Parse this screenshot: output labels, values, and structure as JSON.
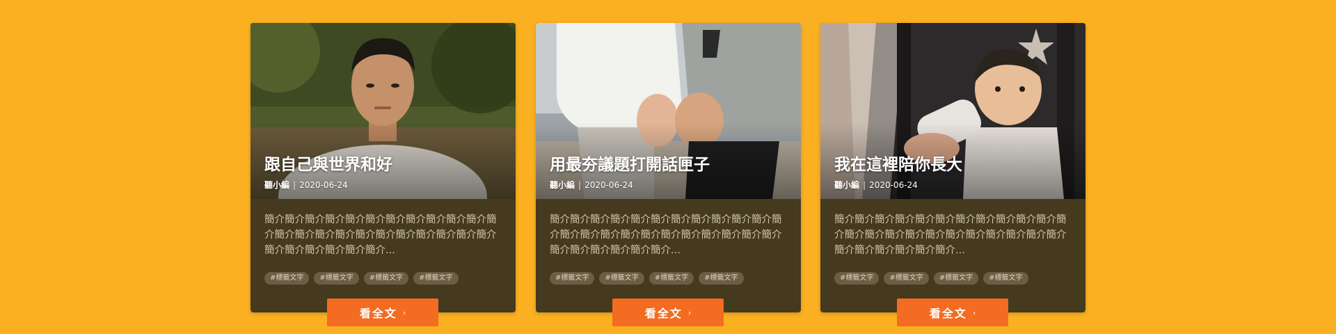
{
  "theme": {
    "background": "#FBB021",
    "card": "#45391E",
    "accent": "#F36C21",
    "tag": "#6B5E44"
  },
  "cards": [
    {
      "image": "portrait-young-man-photo",
      "title": "跟自己與世界和好",
      "author": "聽小編",
      "separator": "|",
      "date": "2020-06-24",
      "excerpt": "簡介簡介簡介簡介簡介簡介簡介簡介簡介簡介簡介簡介簡介簡介簡介簡介簡介簡介簡介簡介簡介簡介簡介簡介簡介簡介簡介簡介簡介...",
      "tags": [
        "#標籤文字",
        "#標籤文字",
        "#標籤文字",
        "#標籤文字"
      ],
      "cta": "看全文",
      "cta_icon": "›"
    },
    {
      "image": "pregnant-couple-beach-photo",
      "title": "用最夯議題打開話匣子",
      "author": "聽小編",
      "separator": "|",
      "date": "2020-06-24",
      "excerpt": "簡介簡介簡介簡介簡介簡介簡介簡介簡介簡介簡介簡介簡介簡介簡介簡介簡介簡介簡介簡介簡介簡介簡介簡介簡介簡介簡介簡介簡介...",
      "tags": [
        "#標籤文字",
        "#標籤文字",
        "#標籤文字",
        "#標籤文字"
      ],
      "cta": "看全文",
      "cta_icon": "›"
    },
    {
      "image": "baby-bottle-feeding-photo",
      "title": "我在這裡陪你長大",
      "author": "聽小編",
      "separator": "|",
      "date": "2020-06-24",
      "excerpt": "簡介簡介簡介簡介簡介簡介簡介簡介簡介簡介簡介簡介簡介簡介簡介簡介簡介簡介簡介簡介簡介簡介簡介簡介簡介簡介簡介簡介簡介...",
      "tags": [
        "#標籤文字",
        "#標籤文字",
        "#標籤文字",
        "#標籤文字"
      ],
      "cta": "看全文",
      "cta_icon": "›"
    }
  ]
}
